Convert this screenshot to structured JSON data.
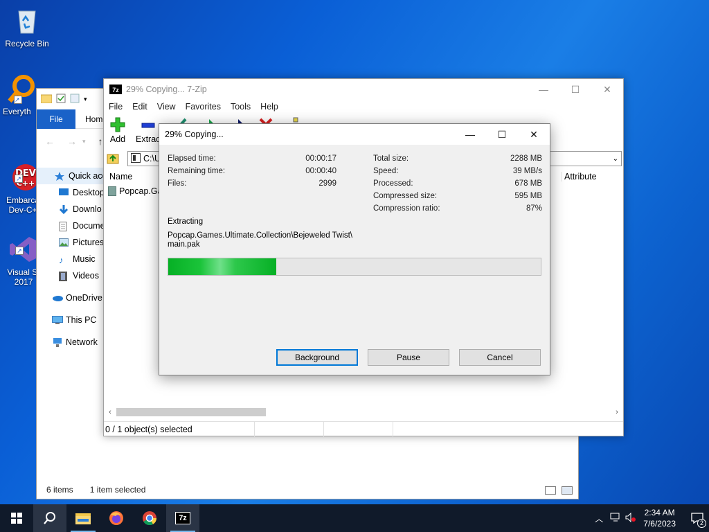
{
  "desktop": {
    "icons": [
      {
        "label": "Recycle Bin"
      },
      {
        "label": "Everyth"
      },
      {
        "label": "Embarca\nDev-C+"
      },
      {
        "label": "Visual St\n2017"
      }
    ]
  },
  "explorer": {
    "ribbon_tabs": [
      "File",
      "Home"
    ],
    "sidebar": [
      "Quick acc",
      "Desktop",
      "Downlo",
      "Docume",
      "Pictures",
      "Music",
      "Videos",
      "OneDrive",
      "This PC",
      "Network"
    ],
    "status_items": "6 items",
    "status_selected": "1 item selected"
  },
  "zip_window": {
    "title": "29% Copying... 7-Zip",
    "logo": "7z",
    "menu": [
      "File",
      "Edit",
      "View",
      "Favorites",
      "Tools",
      "Help"
    ],
    "tools": {
      "add": "Add",
      "extract": "Extrac"
    },
    "address": "C:\\U",
    "columns": {
      "name": "Name",
      "attributes": "Attribute"
    },
    "rows": [
      {
        "name": "Popcap.Ga"
      }
    ],
    "status_selected": "0 / 1 object(s) selected"
  },
  "dialog": {
    "title": "29% Copying...",
    "left_stats": [
      {
        "label": "Elapsed time:",
        "value": "00:00:17"
      },
      {
        "label": "Remaining time:",
        "value": "00:00:40"
      },
      {
        "label": "Files:",
        "value": "2999"
      }
    ],
    "right_stats": [
      {
        "label": "Total size:",
        "value": "2288 MB"
      },
      {
        "label": "Speed:",
        "value": "39 MB/s"
      },
      {
        "label": "Processed:",
        "value": "678 MB"
      },
      {
        "label": "Compressed size:",
        "value": "595 MB"
      },
      {
        "label": "Compression ratio:",
        "value": "87%"
      }
    ],
    "action": "Extracting",
    "path_line1": "Popcap.Games.Ultimate.Collection\\Bejeweled Twist\\",
    "path_line2": "main.pak",
    "progress_percent": 29,
    "buttons": {
      "background": "Background",
      "pause": "Pause",
      "cancel": "Cancel"
    }
  },
  "taskbar": {
    "time": "2:34 AM",
    "date": "7/6/2023",
    "notification_count": "2",
    "zip_label": "7z"
  },
  "colors": {
    "accent": "#0078d7",
    "progress": "#06b025",
    "taskbar": "#101a2a"
  }
}
